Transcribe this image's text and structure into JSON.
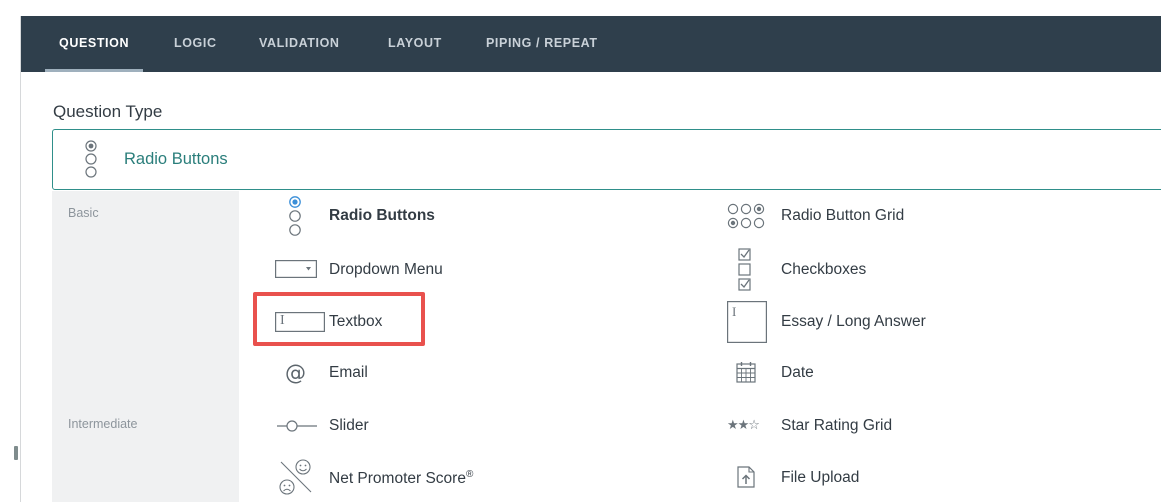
{
  "tabs": [
    {
      "label": "QUESTION",
      "active": true
    },
    {
      "label": "LOGIC",
      "active": false
    },
    {
      "label": "VALIDATION",
      "active": false
    },
    {
      "label": "LAYOUT",
      "active": false
    },
    {
      "label": "PIPING / REPEAT",
      "active": false
    }
  ],
  "question_type": {
    "label": "Question Type",
    "selected": "Radio Buttons"
  },
  "categories": [
    "Basic",
    "Intermediate"
  ],
  "items": {
    "radio_buttons": "Radio Buttons",
    "radio_button_grid": "Radio Button Grid",
    "dropdown_menu": "Dropdown Menu",
    "checkboxes": "Checkboxes",
    "textbox": "Textbox",
    "essay": "Essay / Long Answer",
    "email": "Email",
    "date": "Date",
    "slider": "Slider",
    "star_rating_grid": "Star Rating Grid",
    "nps": "Net Promoter Score",
    "nps_mark": "®",
    "file_upload": "File Upload"
  },
  "colors": {
    "tabbar": "#2f3f4c",
    "accent": "#2f8f8a",
    "highlight": "#e9514d",
    "radio_selected": "#3b8fd8"
  },
  "icons": {
    "textbox_cursor": "I",
    "essay_cursor": "I",
    "email": "@",
    "stars": "★★☆"
  }
}
